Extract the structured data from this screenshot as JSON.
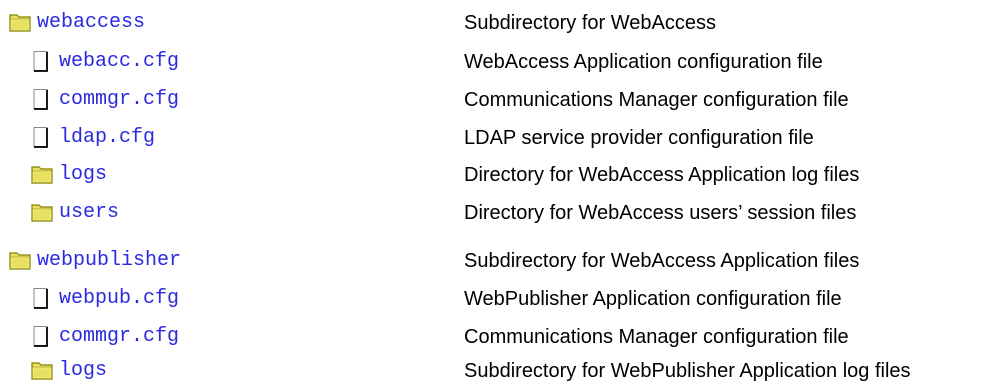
{
  "colors": {
    "link": "#2a2ae0",
    "text": "#000000",
    "folder_fill": "#e8e060",
    "folder_stroke": "#808000",
    "file_fill": "#ffffff",
    "file_stroke": "#000000"
  },
  "tree": [
    {
      "type": "folder",
      "name": "webaccess",
      "description": "Subdirectory for WebAccess",
      "icon": "folder-icon"
    },
    {
      "type": "file",
      "name": "webacc.cfg",
      "description": "WebAccess Application configuration file",
      "icon": "file-icon"
    },
    {
      "type": "file",
      "name": "commgr.cfg",
      "description": "Communications Manager configuration file",
      "icon": "file-icon"
    },
    {
      "type": "file",
      "name": "ldap.cfg",
      "description": "LDAP service provider configuration file",
      "icon": "file-icon"
    },
    {
      "type": "folder",
      "name": "logs",
      "description": "Directory for WebAccess Application log files",
      "icon": "folder-icon"
    },
    {
      "type": "folder",
      "name": "users",
      "description": "Directory for WebAccess users’ session files",
      "icon": "folder-icon"
    },
    {
      "type": "folder",
      "name": "webpublisher",
      "description": "Subdirectory for WebAccess Application files",
      "icon": "folder-icon"
    },
    {
      "type": "file",
      "name": "webpub.cfg",
      "description": "WebPublisher Application configuration file",
      "icon": "file-icon"
    },
    {
      "type": "file",
      "name": "commgr.cfg",
      "description": "Communications Manager configuration file",
      "icon": "file-icon"
    },
    {
      "type": "folder",
      "name": "logs",
      "description": "Subdirectory for WebPublisher Application log files",
      "icon": "folder-icon"
    }
  ]
}
